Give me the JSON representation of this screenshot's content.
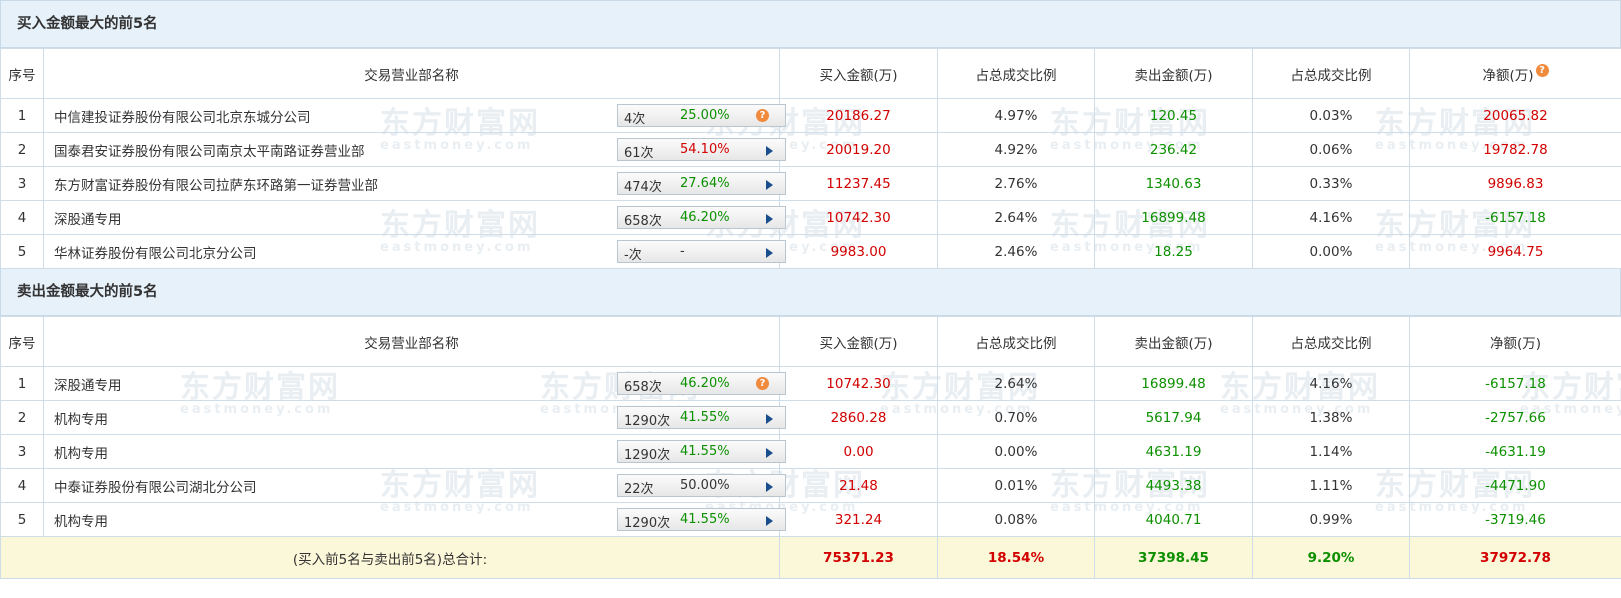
{
  "watermark": {
    "cn": "东方财富网",
    "en": "eastmoney.com"
  },
  "buy_section": {
    "title": "买入金额最大的前5名",
    "headers": [
      "序号",
      "交易营业部名称",
      "买入金额(万)",
      "占总成交比例",
      "卖出金额(万)",
      "占总成交比例",
      "净额(万)"
    ],
    "rows": [
      {
        "idx": "1",
        "name": "中信建投证券股份有限公司北京东城分公司",
        "times": "4次",
        "pct": "25.00%",
        "pct_color": "green",
        "icon": "question-icon",
        "buy": "20186.27",
        "buy_ratio": "4.97%",
        "sell": "120.45",
        "sell_ratio": "0.03%",
        "net": "20065.82",
        "net_color": "red"
      },
      {
        "idx": "2",
        "name": "国泰君安证券股份有限公司南京太平南路证券营业部",
        "times": "61次",
        "pct": "54.10%",
        "pct_color": "red",
        "icon": "arrow-right-icon",
        "buy": "20019.20",
        "buy_ratio": "4.92%",
        "sell": "236.42",
        "sell_ratio": "0.06%",
        "net": "19782.78",
        "net_color": "red"
      },
      {
        "idx": "3",
        "name": "东方财富证券股份有限公司拉萨东环路第一证券营业部",
        "times": "474次",
        "pct": "27.64%",
        "pct_color": "green",
        "icon": "arrow-right-icon",
        "buy": "11237.45",
        "buy_ratio": "2.76%",
        "sell": "1340.63",
        "sell_ratio": "0.33%",
        "net": "9896.83",
        "net_color": "red"
      },
      {
        "idx": "4",
        "name": "深股通专用",
        "times": "658次",
        "pct": "46.20%",
        "pct_color": "green",
        "icon": "arrow-right-icon",
        "buy": "10742.30",
        "buy_ratio": "2.64%",
        "sell": "16899.48",
        "sell_ratio": "4.16%",
        "net": "-6157.18",
        "net_color": "green"
      },
      {
        "idx": "5",
        "name": "华林证券股份有限公司北京分公司",
        "times": "-次",
        "pct": "-",
        "pct_color": "dark",
        "icon": "arrow-right-icon",
        "buy": "9983.00",
        "buy_ratio": "2.46%",
        "sell": "18.25",
        "sell_ratio": "0.00%",
        "net": "9964.75",
        "net_color": "red"
      }
    ]
  },
  "sell_section": {
    "title": "卖出金额最大的前5名",
    "headers": [
      "序号",
      "交易营业部名称",
      "买入金额(万)",
      "占总成交比例",
      "卖出金额(万)",
      "占总成交比例",
      "净额(万)"
    ],
    "rows": [
      {
        "idx": "1",
        "name": "深股通专用",
        "times": "658次",
        "pct": "46.20%",
        "pct_color": "green",
        "icon": "question-icon",
        "buy": "10742.30",
        "buy_ratio": "2.64%",
        "sell": "16899.48",
        "sell_ratio": "4.16%",
        "net": "-6157.18",
        "net_color": "green"
      },
      {
        "idx": "2",
        "name": "机构专用",
        "times": "1290次",
        "pct": "41.55%",
        "pct_color": "green",
        "icon": "arrow-right-icon",
        "buy": "2860.28",
        "buy_ratio": "0.70%",
        "sell": "5617.94",
        "sell_ratio": "1.38%",
        "net": "-2757.66",
        "net_color": "green"
      },
      {
        "idx": "3",
        "name": "机构专用",
        "times": "1290次",
        "pct": "41.55%",
        "pct_color": "green",
        "icon": "arrow-right-icon",
        "buy": "0.00",
        "buy_ratio": "0.00%",
        "sell": "4631.19",
        "sell_ratio": "1.14%",
        "net": "-4631.19",
        "net_color": "green"
      },
      {
        "idx": "4",
        "name": "中泰证券股份有限公司湖北分公司",
        "times": "22次",
        "pct": "50.00%",
        "pct_color": "dark",
        "icon": "arrow-right-icon",
        "buy": "21.48",
        "buy_ratio": "0.01%",
        "sell": "4493.38",
        "sell_ratio": "1.11%",
        "net": "-4471.90",
        "net_color": "green"
      },
      {
        "idx": "5",
        "name": "机构专用",
        "times": "1290次",
        "pct": "41.55%",
        "pct_color": "green",
        "icon": "arrow-right-icon",
        "buy": "321.24",
        "buy_ratio": "0.08%",
        "sell": "4040.71",
        "sell_ratio": "0.99%",
        "net": "-3719.46",
        "net_color": "green"
      }
    ]
  },
  "total": {
    "label": "(买入前5名与卖出前5名)总合计:",
    "buy": "75371.23",
    "buy_ratio": "18.54%",
    "sell": "37398.45",
    "sell_ratio": "9.20%",
    "net": "37972.78"
  },
  "colors": {
    "red": "#d20000",
    "green": "#0c9000",
    "header_bg": "#e7f1fa",
    "total_bg": "#fbf7d9",
    "icon_orange": "#f08a3c",
    "arrow_blue": "#1b4e8c"
  }
}
